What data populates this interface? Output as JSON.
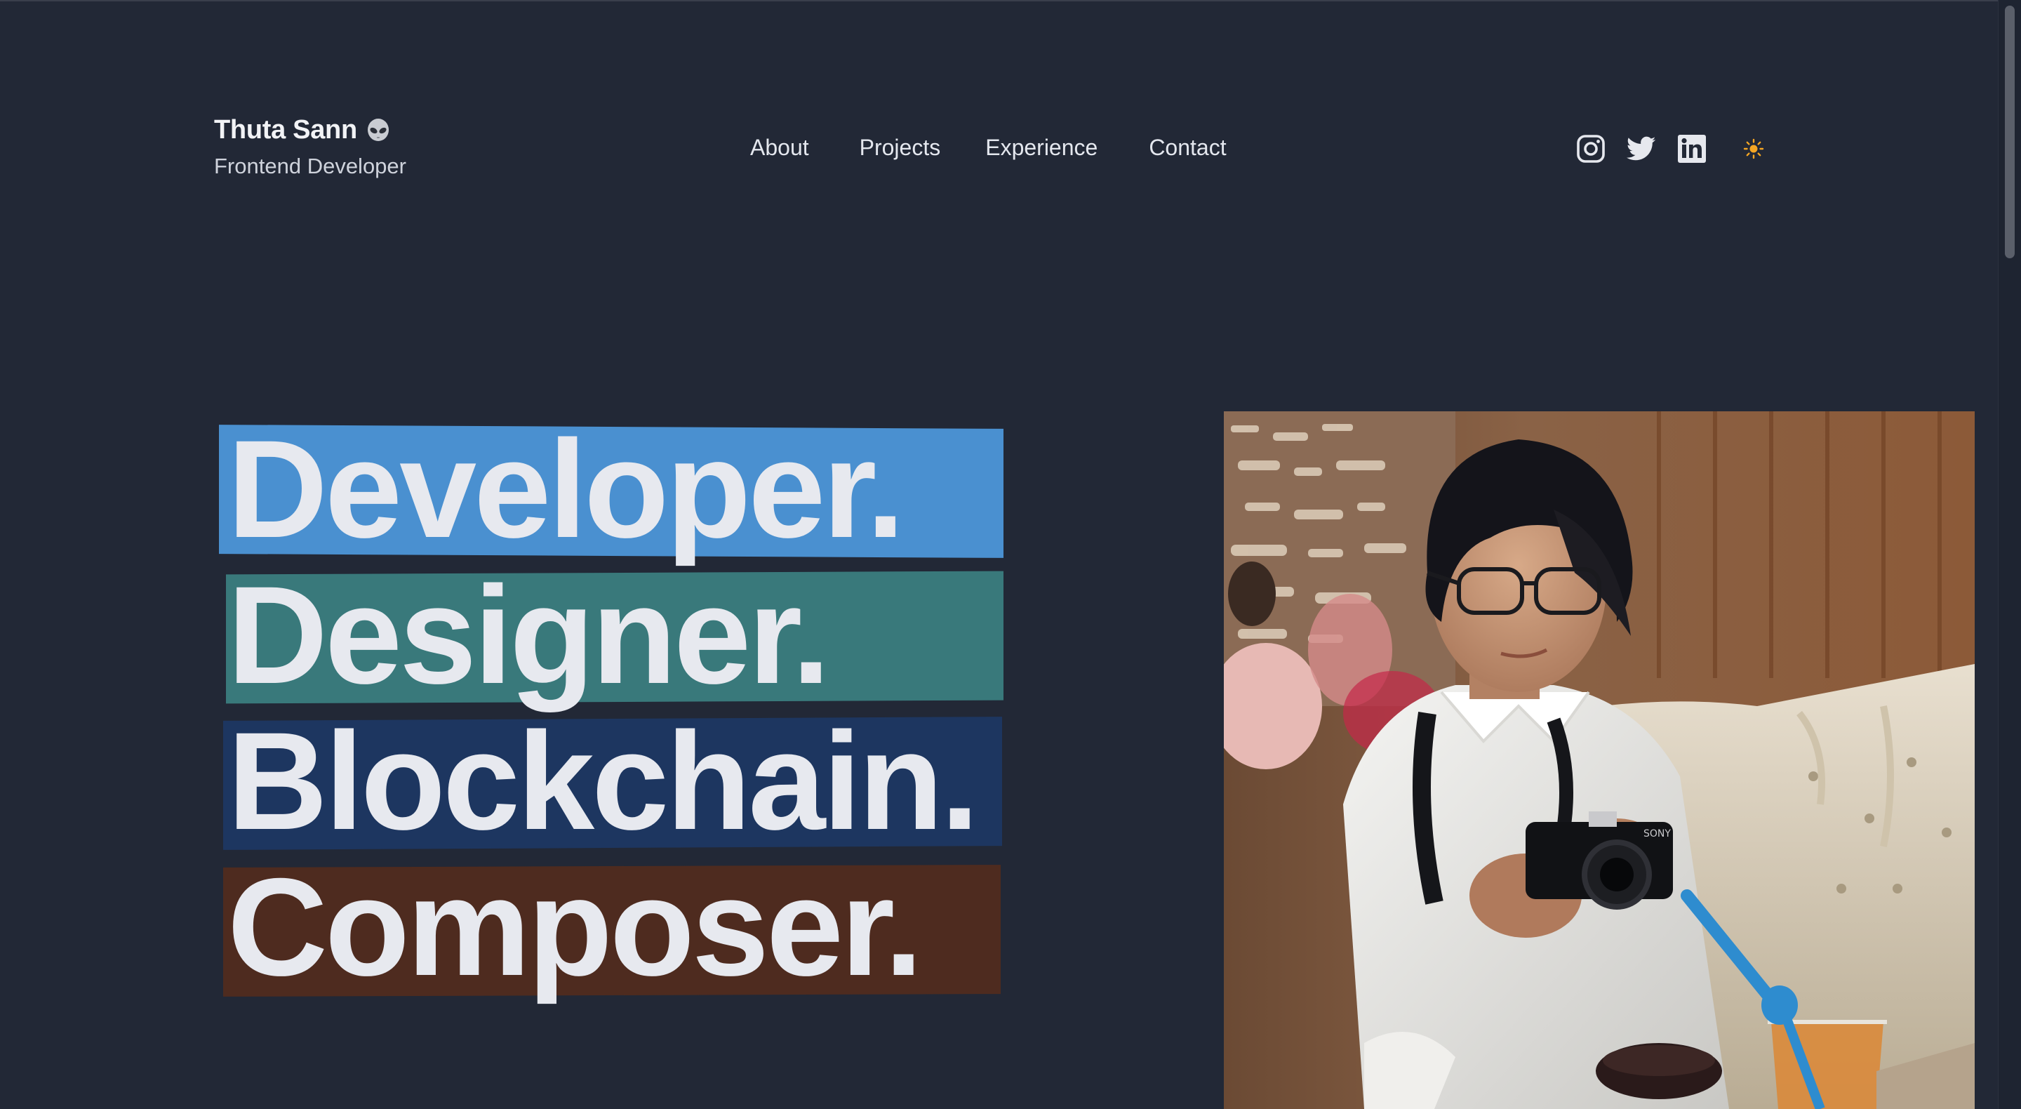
{
  "brand": {
    "name": "Thuta Sann",
    "emoji_icon": "alien-icon",
    "role": "Frontend Developer"
  },
  "nav": {
    "items": [
      {
        "label": "About"
      },
      {
        "label": "Projects"
      },
      {
        "label": "Experience"
      },
      {
        "label": "Contact"
      }
    ]
  },
  "socials": {
    "items": [
      {
        "icon": "instagram-icon"
      },
      {
        "icon": "twitter-icon"
      },
      {
        "icon": "linkedin-icon"
      }
    ],
    "theme_toggle_icon": "sun-icon"
  },
  "hero": {
    "words": [
      {
        "text": "Developer.",
        "color": "#4a90d0"
      },
      {
        "text": "Designer.",
        "color": "#39797b"
      },
      {
        "text": "Blockchain.",
        "color": "#1d3660"
      },
      {
        "text": "Composer.",
        "color": "#4e2b1f"
      }
    ]
  },
  "photo": {
    "subject": "portrait-photo"
  },
  "colors": {
    "background": "#222836",
    "text": "#e7e9ef",
    "sun": "#f5a623"
  }
}
